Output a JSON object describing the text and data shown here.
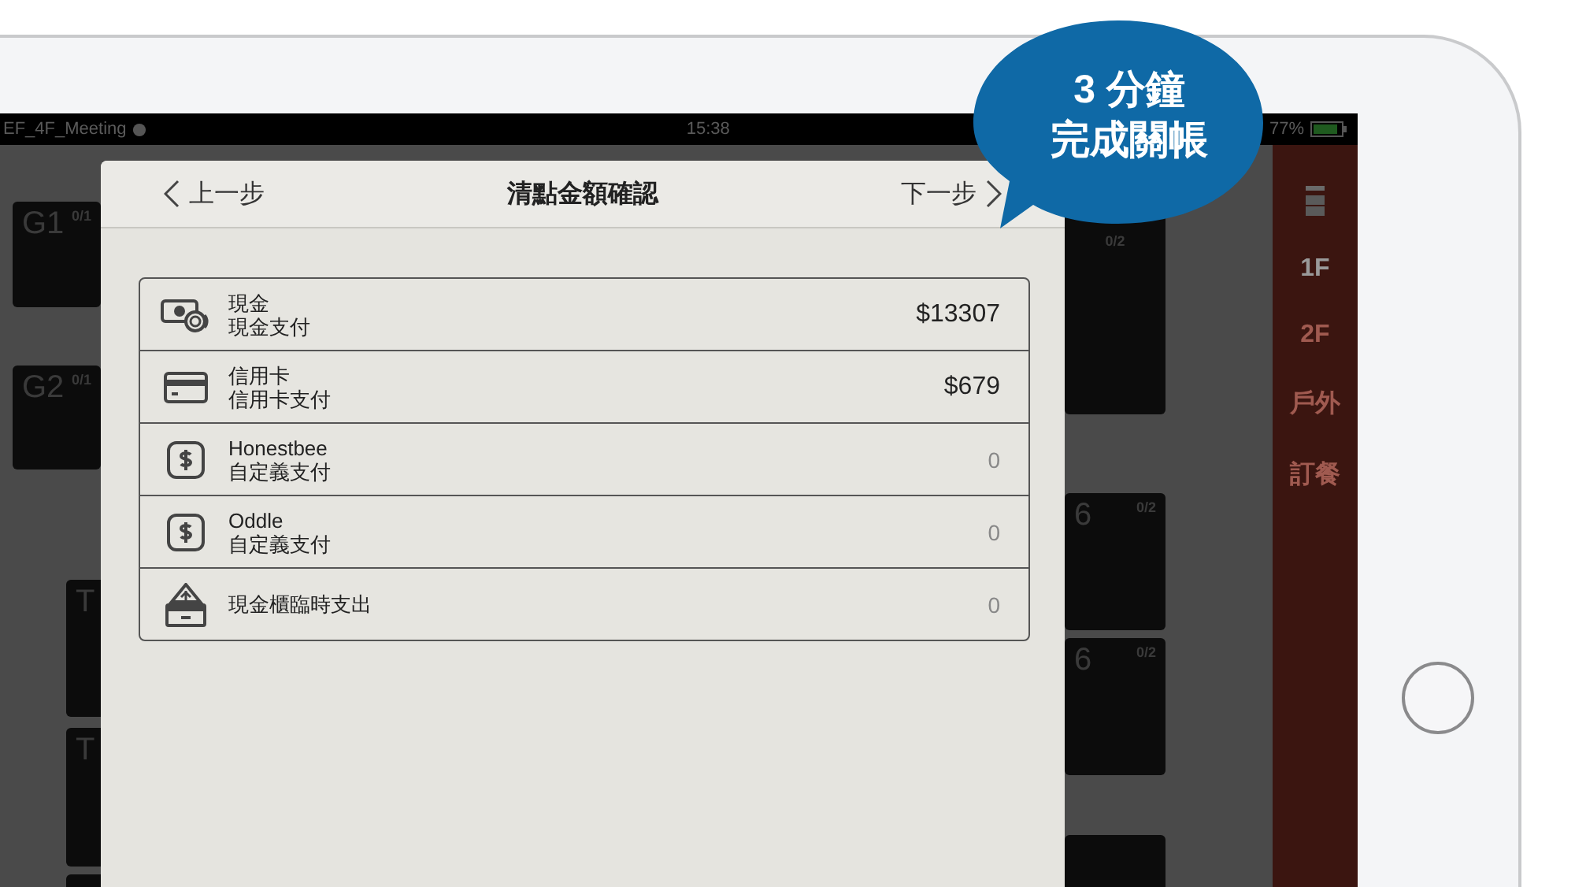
{
  "status_bar": {
    "network": "EF_4F_Meeting",
    "time": "15:38",
    "battery": "77%"
  },
  "floor_tiles": [
    {
      "name": "G1",
      "count": "0/1"
    },
    {
      "name": "G2",
      "count": "0/1"
    },
    {
      "name": "T"
    },
    {
      "name": "T"
    },
    {
      "count": "0/2"
    },
    {
      "name": "6",
      "count": "0/2"
    },
    {
      "name": "6",
      "count": "0/2"
    }
  ],
  "sidebar": {
    "items": [
      {
        "label": "1F",
        "selected": true
      },
      {
        "label": "2F",
        "selected": false
      },
      {
        "label": "戶外",
        "selected": false
      },
      {
        "label": "訂餐",
        "selected": false
      }
    ]
  },
  "dialog": {
    "back": "上一步",
    "title": "清點金額確認",
    "next": "下一步",
    "rows": [
      {
        "kind": "cash",
        "name": "現金",
        "method": "現金支付",
        "amount": "$13307",
        "muted": false
      },
      {
        "kind": "card",
        "name": "信用卡",
        "method": "信用卡支付",
        "amount": "$679",
        "muted": false
      },
      {
        "kind": "custom",
        "name": "Honestbee",
        "method": "自定義支付",
        "amount": "0",
        "muted": true
      },
      {
        "kind": "custom",
        "name": "Oddle",
        "method": "自定義支付",
        "amount": "0",
        "muted": true
      },
      {
        "kind": "drawer",
        "name": "現金櫃臨時支出",
        "amount": "0",
        "muted": true
      }
    ]
  },
  "bubble": {
    "lines": [
      "3 分鐘",
      "完成關帳"
    ]
  }
}
